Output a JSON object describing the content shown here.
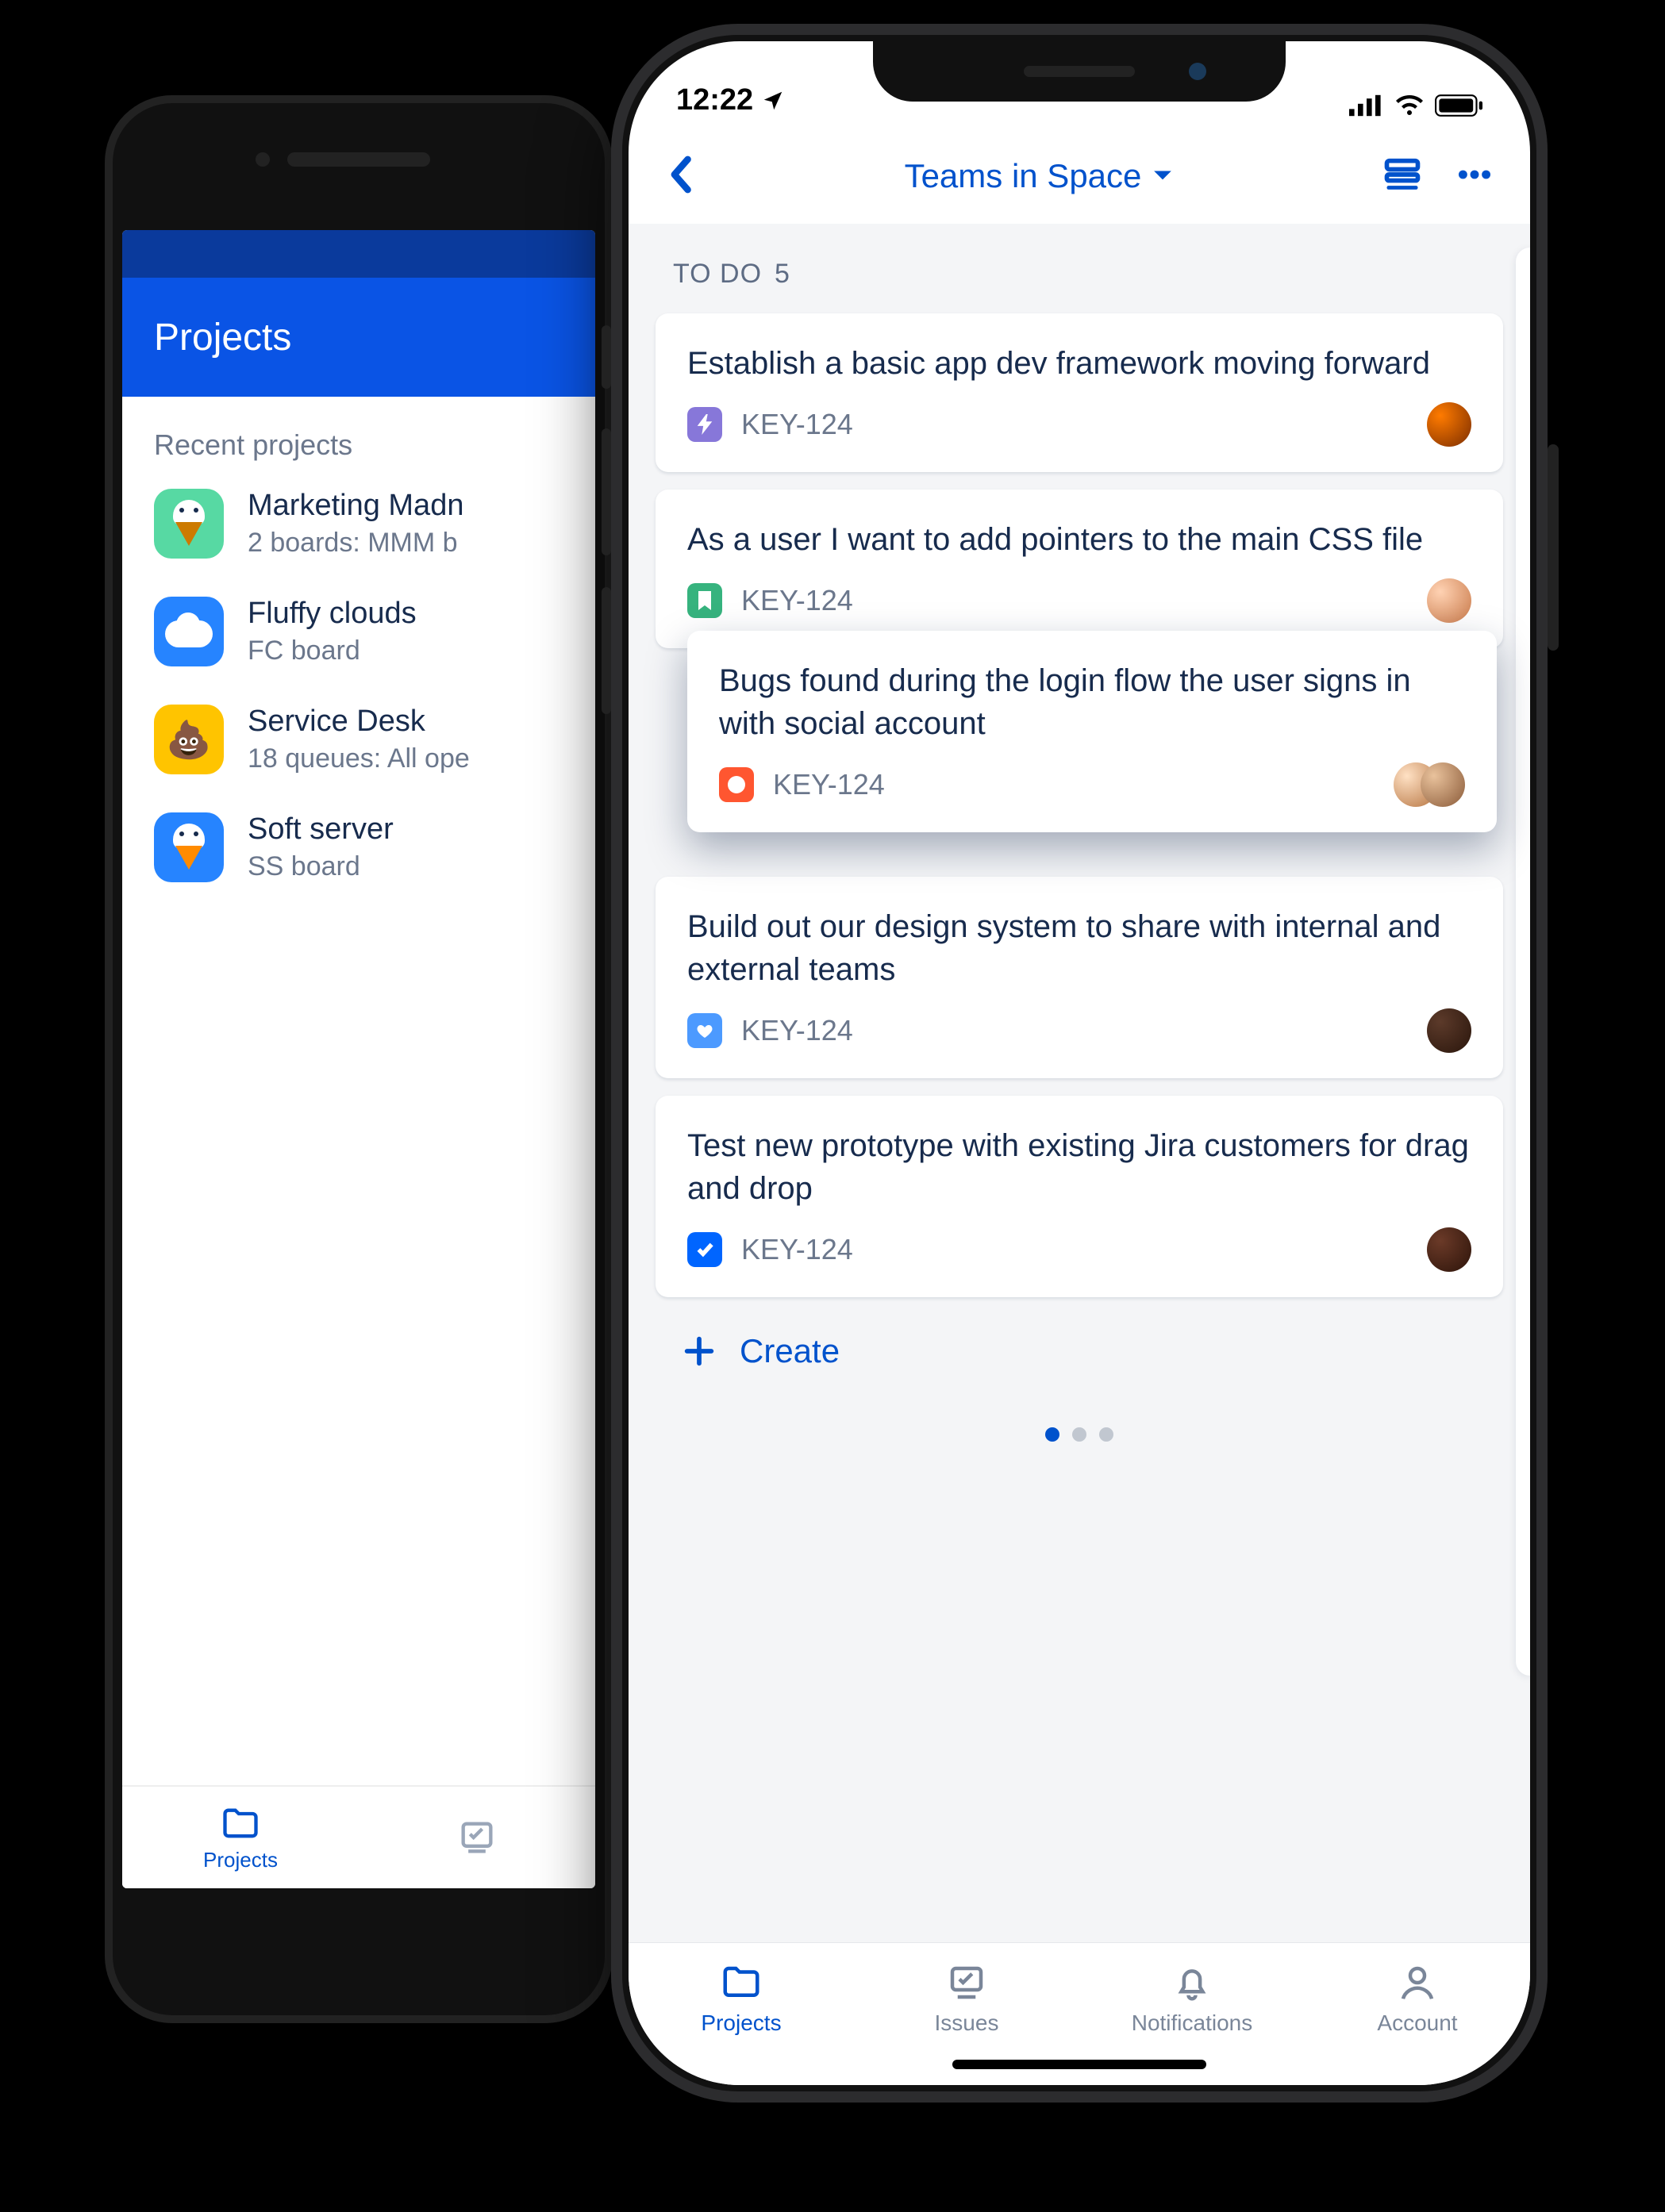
{
  "android": {
    "appbar_title": "Projects",
    "section_label": "Recent projects",
    "items": [
      {
        "title": "Marketing Madn",
        "subtitle": "2 boards: MMM b"
      },
      {
        "title": "Fluffy clouds",
        "subtitle": "FC board"
      },
      {
        "title": "Service Desk",
        "subtitle": "18 queues: All ope"
      },
      {
        "title": "Soft server",
        "subtitle": "SS board"
      }
    ],
    "bottom": {
      "projects": "Projects"
    }
  },
  "ios": {
    "status_time": "12:22",
    "nav_title": "Teams in Space",
    "column": {
      "label": "TO DO",
      "count": "5"
    },
    "cards": [
      {
        "title": "Establish a basic app dev framework moving forward",
        "key": "KEY-124",
        "type": "epic"
      },
      {
        "title": "As a user I want to add pointers to the main CSS file",
        "key": "KEY-124",
        "type": "story"
      },
      {
        "title": "Bugs found during the login flow the user signs in with social account",
        "key": "KEY-124",
        "type": "bug",
        "dragging": true
      },
      {
        "title": "Build out our design system to share with internal and external teams",
        "key": "KEY-124",
        "type": "improv"
      },
      {
        "title": "Test new prototype with existing Jira customers for drag and drop",
        "key": "KEY-124",
        "type": "task"
      }
    ],
    "create_label": "Create",
    "tabs": {
      "projects": "Projects",
      "issues": "Issues",
      "notifications": "Notifications",
      "account": "Account"
    }
  }
}
